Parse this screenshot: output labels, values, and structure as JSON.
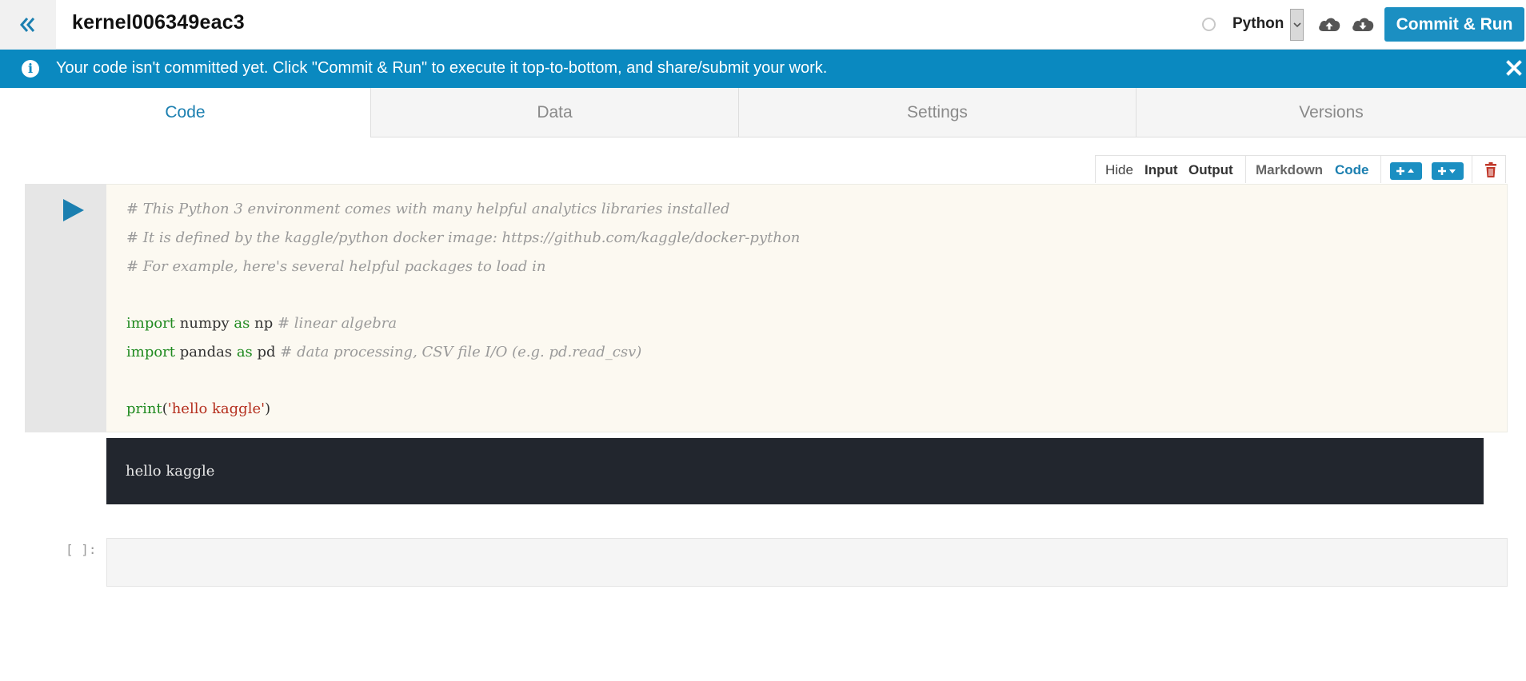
{
  "header": {
    "title": "kernel006349eac3",
    "language": "Python",
    "commit_label": "Commit & Run"
  },
  "banner": {
    "message": "Your code isn't committed yet. Click \"Commit & Run\" to execute it top-to-bottom, and share/submit your work."
  },
  "tabs": [
    {
      "label": "Code",
      "active": true
    },
    {
      "label": "Data",
      "active": false
    },
    {
      "label": "Settings",
      "active": false
    },
    {
      "label": "Versions",
      "active": false
    }
  ],
  "cell_toolbar": {
    "hide": "Hide",
    "input": "Input",
    "output": "Output",
    "markdown": "Markdown",
    "code": "Code"
  },
  "code_cell": {
    "lines": {
      "l1": "# This Python 3 environment comes with many helpful analytics libraries installed",
      "l2": "# It is defined by the kaggle/python docker image: https://github.com/kaggle/docker-python",
      "l3": "# For example, here's several helpful packages to load in",
      "l5": {
        "kw1": "import",
        "mod": " numpy ",
        "kw2": "as",
        "alias": " np ",
        "comment": "# linear algebra"
      },
      "l6": {
        "kw1": "import",
        "mod": " pandas ",
        "kw2": "as",
        "alias": " pd ",
        "comment": "# data processing, CSV file I/O (e.g. pd.read_csv)"
      },
      "l8": {
        "fn": "print",
        "open": "(",
        "str": "'hello kaggle'",
        "close": ")"
      }
    },
    "output": "hello kaggle"
  },
  "empty_cell": {
    "prompt": "[ ]:"
  },
  "colors": {
    "accent": "#1b8fc2",
    "banner": "#0a89c0",
    "output_bg": "#22262e",
    "code_bg": "#fcf9f1",
    "delete": "#c0392b"
  },
  "icons": [
    "double-chevron-left-icon",
    "spinner-icon",
    "chevron-down-icon",
    "cloud-upload-icon",
    "cloud-download-icon",
    "info-icon",
    "close-icon",
    "play-icon",
    "trash-icon"
  ]
}
